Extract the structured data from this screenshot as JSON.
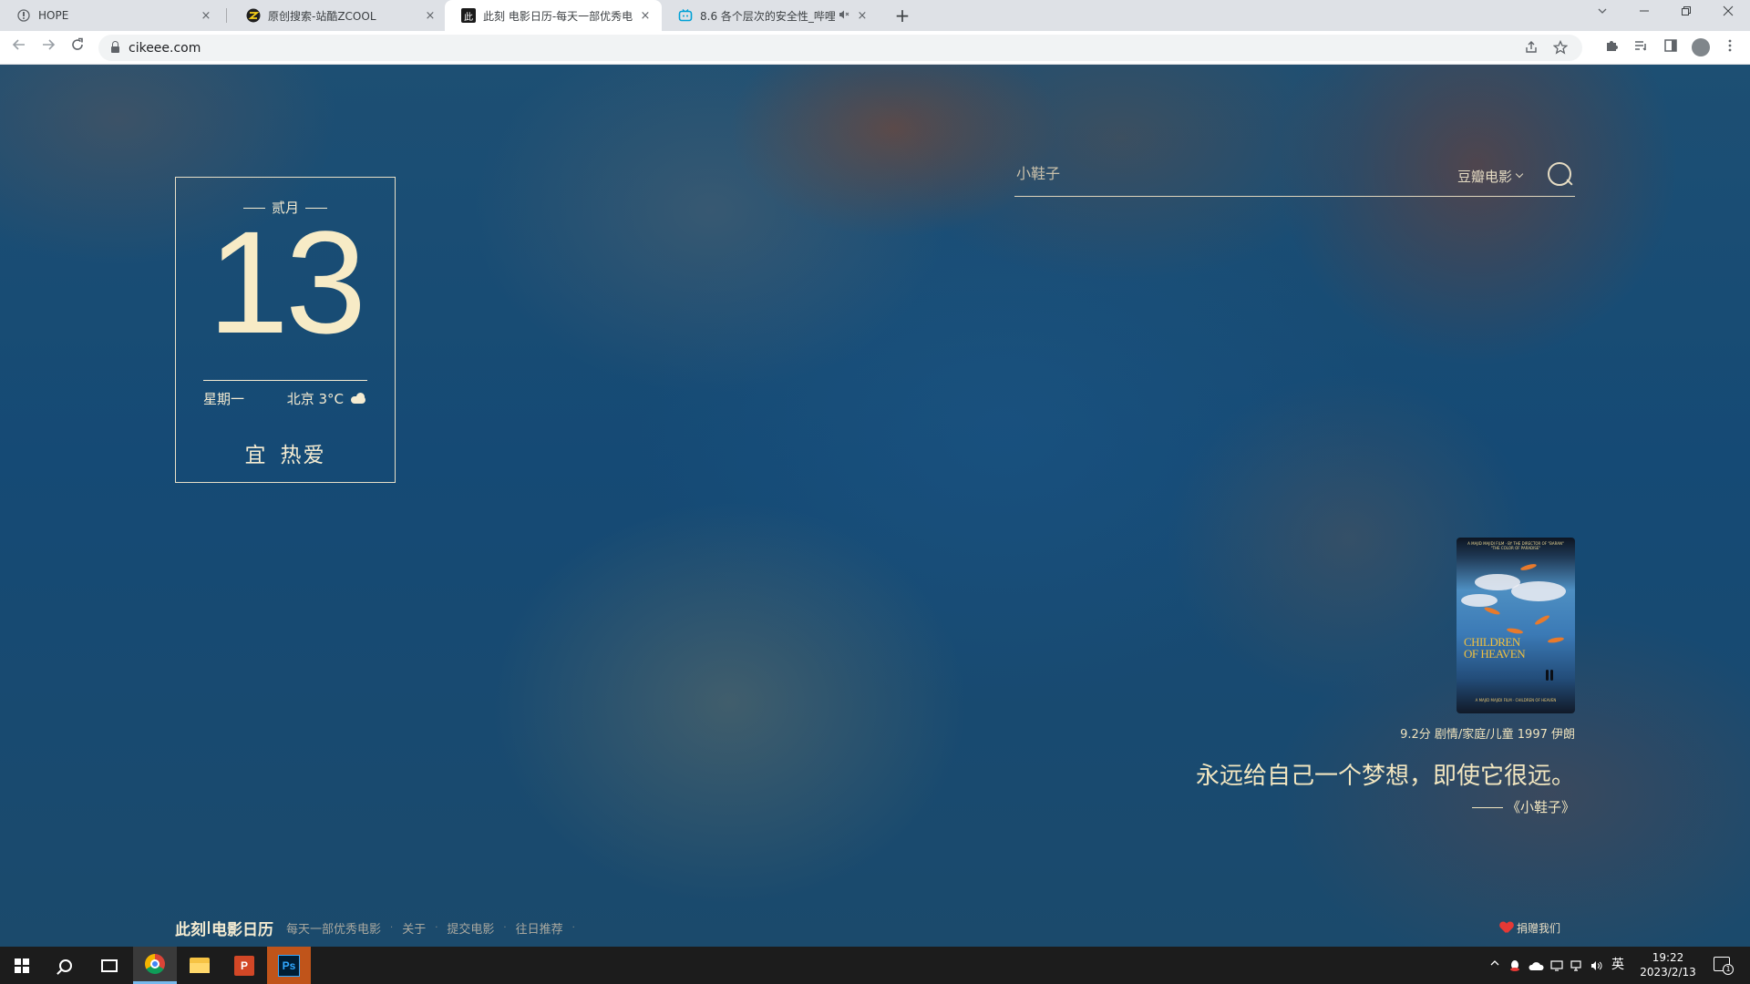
{
  "browser": {
    "tabs": [
      {
        "title": "HOPE",
        "favicon": "hope-favicon"
      },
      {
        "title": "原创搜索-站酷ZCOOL",
        "favicon": "zcool-favicon"
      },
      {
        "title": "此刻 电影日历-每天一部优秀电影",
        "favicon": "cikeee-favicon",
        "favicon_text": "此",
        "active": true
      },
      {
        "title": "8.6 各个层次的安全性_哔哩",
        "favicon": "bilibili-favicon",
        "muted": true
      }
    ],
    "close_glyph": "×",
    "new_tab_glyph": "+",
    "url": "cikeee.com"
  },
  "calendar": {
    "month": "贰月",
    "day": "13",
    "weekday": "星期一",
    "weather": "北京 3°C",
    "weather_icon": "cloud-sun-icon",
    "yi_label": "宜",
    "yi_value": "热爱"
  },
  "search": {
    "placeholder": "小鞋子",
    "source": "豆瓣电影"
  },
  "movie": {
    "poster_title_line1": "CHILDREN",
    "poster_title_line2": "OF HEAVEN",
    "poster_top_text": "A MAJID MAJIDI FILM · BY THE DIRECTOR OF \"BARAN\" \"THE COLOR OF PARADISE\"",
    "poster_bottom_text": "A MAJID MAJIDI FILM · CHILDREN OF HEAVEN",
    "meta": "9.2分 剧情/家庭/儿童 1997 伊朗",
    "quote": "永远给自己一个梦想，即使它很远。",
    "quote_source": "《小鞋子》"
  },
  "footer": {
    "brand_left": "此刻",
    "brand_right": "电影日历",
    "links": [
      "每天一部优秀电影",
      "关于",
      "提交电影",
      "往日推荐"
    ],
    "separator": "·",
    "donate": "捐赠我们",
    "accent_color": "#e53935"
  },
  "taskbar": {
    "ime": "英",
    "time": "19:22",
    "date": "2023/2/13",
    "notification_count": "1",
    "active_accent": "#76b9ed"
  }
}
